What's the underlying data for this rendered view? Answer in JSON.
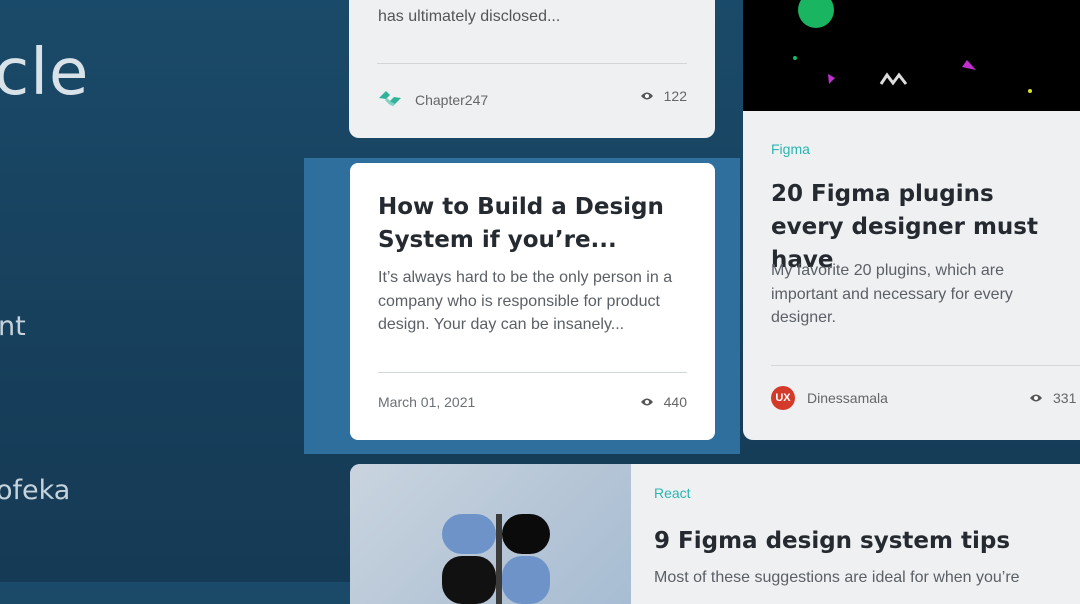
{
  "background": {
    "title_fragment": "cle",
    "line1_fragment": "nt",
    "line2_fragment": "ofeka"
  },
  "cards": {
    "top": {
      "excerpt_tail": "has ultimately disclosed...",
      "author": "Chapter247",
      "views": "122"
    },
    "featured": {
      "title": "How to Build a Design System if you’re...",
      "excerpt": "It’s always hard to be the only person in a company who is responsible for product design. Your day can be insanely...",
      "date": "March 01, 2021",
      "views": "440"
    },
    "right": {
      "tag": "Figma",
      "title": "20 Figma plugins every designer must have",
      "excerpt": "My favorite 20 plugins, which are important and necessary for every designer.",
      "author": "Dinessamala",
      "author_avatar": "UX",
      "views": "331"
    },
    "bottom": {
      "tag": "React",
      "title": "9 Figma design system tips",
      "excerpt_partial": "Most of these suggestions are ideal for when you’re"
    }
  },
  "colors": {
    "background": "#17405c",
    "highlight": "#2f6f9d",
    "tag": "#2eb5b0"
  },
  "icons": {
    "views": "eye-icon",
    "chapter247_logo": "chapter247-logo-icon",
    "figma_logo": "figma-logo-icon"
  }
}
